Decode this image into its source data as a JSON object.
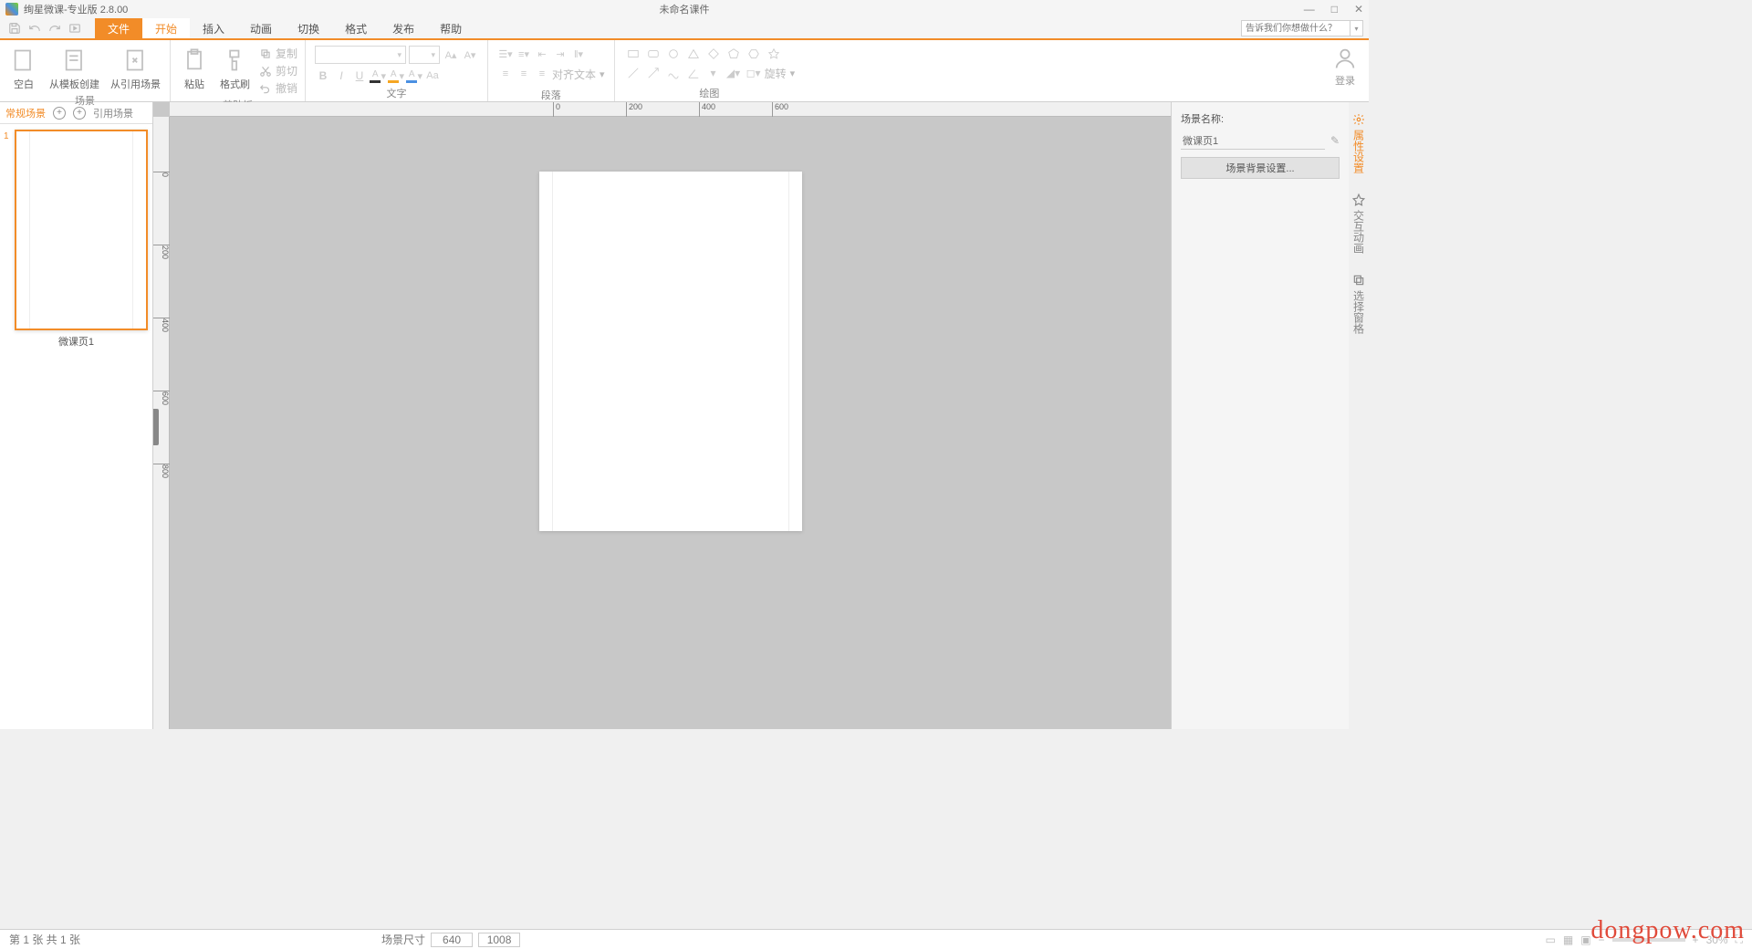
{
  "app": {
    "name": "绚星微课-专业版 2.8.00",
    "doc_title": "未命名课件"
  },
  "win": {
    "min": "—",
    "max": "□",
    "close": "✕"
  },
  "menu": {
    "file": "文件",
    "start": "开始",
    "insert": "插入",
    "anim": "动画",
    "trans": "切换",
    "format": "格式",
    "publish": "发布",
    "help": "帮助"
  },
  "help_placeholder": "告诉我们你想做什么？",
  "ribbon": {
    "scene": {
      "label": "场景",
      "blank": "空白",
      "fromtpl": "从模板创建",
      "fromref": "从引用场景"
    },
    "clip": {
      "label": "剪贴板",
      "paste": "粘贴",
      "brush": "格式刷",
      "copy": "复制",
      "cut": "剪切",
      "undo": "撤销"
    },
    "text": {
      "label": "文字"
    },
    "para": {
      "label": "段落",
      "align": "对齐文本"
    },
    "draw": {
      "label": "绘图",
      "rotate": "旋转"
    }
  },
  "login_label": "登录",
  "left": {
    "tab_default": "常规场景",
    "tab_ref": "引用场景",
    "thumb_label": "微课页1",
    "thumb_num": "1"
  },
  "right": {
    "name_label": "场景名称:",
    "name_value": "微课页1",
    "bg_btn": "场景背景设置..."
  },
  "sidetabs": {
    "props": "属性设置",
    "anim": "交互动画",
    "style": "选择窗格"
  },
  "status": {
    "page": "第 1 张  共 1 张",
    "dim_label": "场景尺寸",
    "w": "640",
    "h": "1008",
    "zoom": "30%"
  },
  "ruler": {
    "h": [
      "0",
      "200",
      "400",
      "600"
    ],
    "v": [
      "0",
      "200",
      "400",
      "600",
      "800"
    ]
  },
  "watermark": "dongpow.com"
}
